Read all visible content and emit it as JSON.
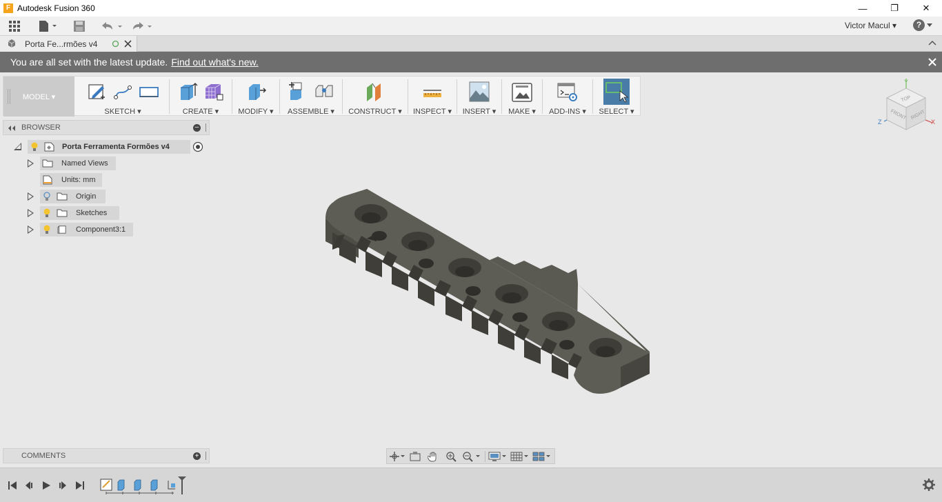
{
  "window": {
    "title": "Autodesk Fusion 360",
    "app_icon": "F",
    "minimize": "—",
    "restore": "❐",
    "close": "✕"
  },
  "qat": {
    "user": "Victor Macul ▾",
    "help": "?"
  },
  "document": {
    "tab_label": "Porta Fe...rmões v4"
  },
  "banner": {
    "message": "You are all set with the latest update.",
    "link": "Find out what's new."
  },
  "toolbar": {
    "workspace": "MODEL ▾",
    "groups": {
      "sketch": "SKETCH ▾",
      "create": "CREATE ▾",
      "modify": "MODIFY ▾",
      "assemble": "ASSEMBLE ▾",
      "construct": "CONSTRUCT ▾",
      "inspect": "INSPECT ▾",
      "insert": "INSERT ▾",
      "make": "MAKE ▾",
      "addins": "ADD-INS ▾",
      "select": "SELECT ▾"
    }
  },
  "browser": {
    "title": "BROWSER",
    "root": "Porta Ferramenta Formões v4",
    "items": {
      "named_views": "Named Views",
      "units": "Units: mm",
      "origin": "Origin",
      "sketches": "Sketches",
      "component": "Component3:1"
    }
  },
  "comments": {
    "title": "COMMENTS"
  },
  "viewcube": {
    "top": "TOP",
    "front": "FRONT",
    "right": "RIGHT",
    "axis_x": "X",
    "axis_y": "Y",
    "axis_z": "Z"
  },
  "colors": {
    "banner_bg": "#6e6e6e",
    "select_active": "#4a7ca8",
    "bulb": "#f4c430",
    "model_face": "#5b5a52"
  }
}
